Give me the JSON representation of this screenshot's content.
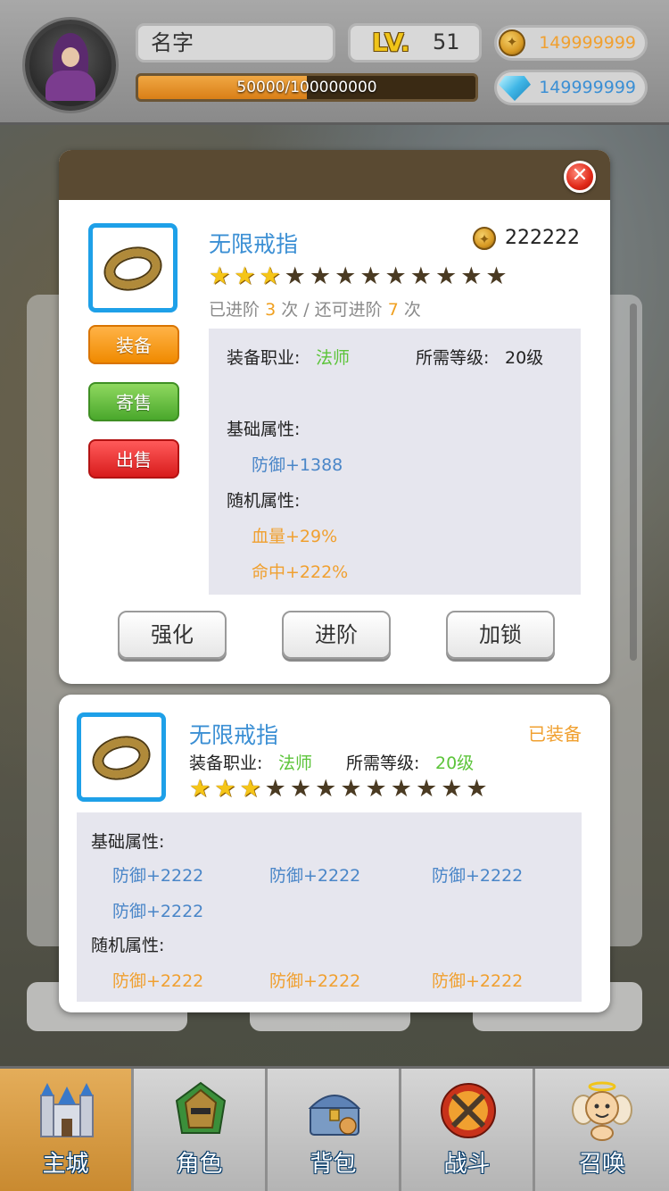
{
  "header": {
    "player_name": "名字",
    "level_label": "LV.",
    "level_value": "51",
    "exp_text": "50000/100000000",
    "exp_progress": 0.5,
    "gold_value": "149999999",
    "gem_value": "149999999",
    "gold_icon": "coin-icon",
    "gem_icon": "gem-icon"
  },
  "item_detail": {
    "name": "无限戒指",
    "price": "222222",
    "stars_total": 12,
    "stars_filled": 3,
    "advance_prefix": "已进阶",
    "advance_done": "3",
    "advance_mid": "次 / 还可进阶",
    "advance_left": "7",
    "advance_suffix": "次",
    "buttons": {
      "equip": "装备",
      "consign": "寄售",
      "sell": "出售"
    },
    "class_label": "装备职业:",
    "class_value": "法师",
    "level_req_label": "所需等级:",
    "level_req_value": "20级",
    "base_attr_label": "基础属性:",
    "base_attrs": [
      "防御+1388"
    ],
    "random_attr_label": "随机属性:",
    "random_attrs": [
      "血量+29%",
      "命中+222%"
    ],
    "actions": {
      "enhance": "强化",
      "advance": "进阶",
      "lock": "加锁"
    }
  },
  "equipped_item": {
    "name": "无限戒指",
    "status": "已装备",
    "class_label": "装备职业:",
    "class_value": "法师",
    "level_req_label": "所需等级:",
    "level_req_value": "20级",
    "stars_total": 12,
    "stars_filled": 3,
    "base_attr_label": "基础属性:",
    "base_attrs": [
      "防御+2222",
      "防御+2222",
      "防御+2222",
      "防御+2222"
    ],
    "random_attr_label": "随机属性:",
    "random_attrs": [
      "防御+2222",
      "防御+2222",
      "防御+2222"
    ]
  },
  "nav": {
    "items": [
      {
        "label": "主城",
        "icon": "castle-icon"
      },
      {
        "label": "角色",
        "icon": "helmet-icon"
      },
      {
        "label": "背包",
        "icon": "treasure-chest-icon"
      },
      {
        "label": "战斗",
        "icon": "crossed-swords-icon"
      },
      {
        "label": "召唤",
        "icon": "angel-icon"
      }
    ],
    "active_index": 0
  },
  "colors": {
    "accent_blue": "#3b8fd4",
    "star_gold": "#f5c518",
    "equipped_orange": "#f0a030",
    "class_green": "#5cc43a"
  }
}
